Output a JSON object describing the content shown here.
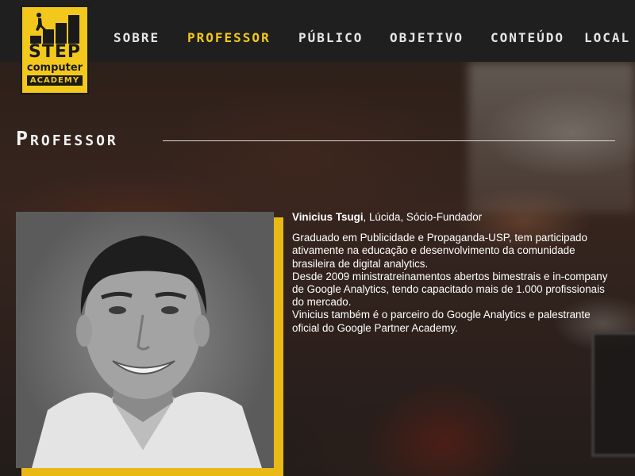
{
  "logo": {
    "line1": "STEP",
    "line2": "computer",
    "line3": "ACADEMY",
    "icon": "climber-on-steps-icon",
    "color": "#f3c81c"
  },
  "nav": {
    "items": [
      {
        "label": "SOBRE"
      },
      {
        "label": "PROFESSOR",
        "active": true
      },
      {
        "label": "PÚBLICO"
      },
      {
        "label": "OBJETIVO"
      },
      {
        "label": "CONTEÚDO"
      },
      {
        "label": "LOCAL"
      }
    ],
    "active_color": "#f3c81c"
  },
  "section": {
    "title": "Professor"
  },
  "professor": {
    "name": "Vinicius Tsugi",
    "role": ", Lúcida, Sócio-Fundador",
    "bio": [
      "Graduado em Publicidade e Propaganda-USP, tem participado ativamente na educação e desenvolvimento da comunidade brasileira de digital analytics.",
      "Desde 2009 ministratreinamentos abertos bimestrais e in-company de Google Analytics, tendo capacitado mais de 1.000 profissionais do mercado.",
      "Vinicius também é o parceiro do Google Analytics e palestrante oficial do Google Partner Academy."
    ],
    "photo_accent_color": "#e9b916"
  }
}
